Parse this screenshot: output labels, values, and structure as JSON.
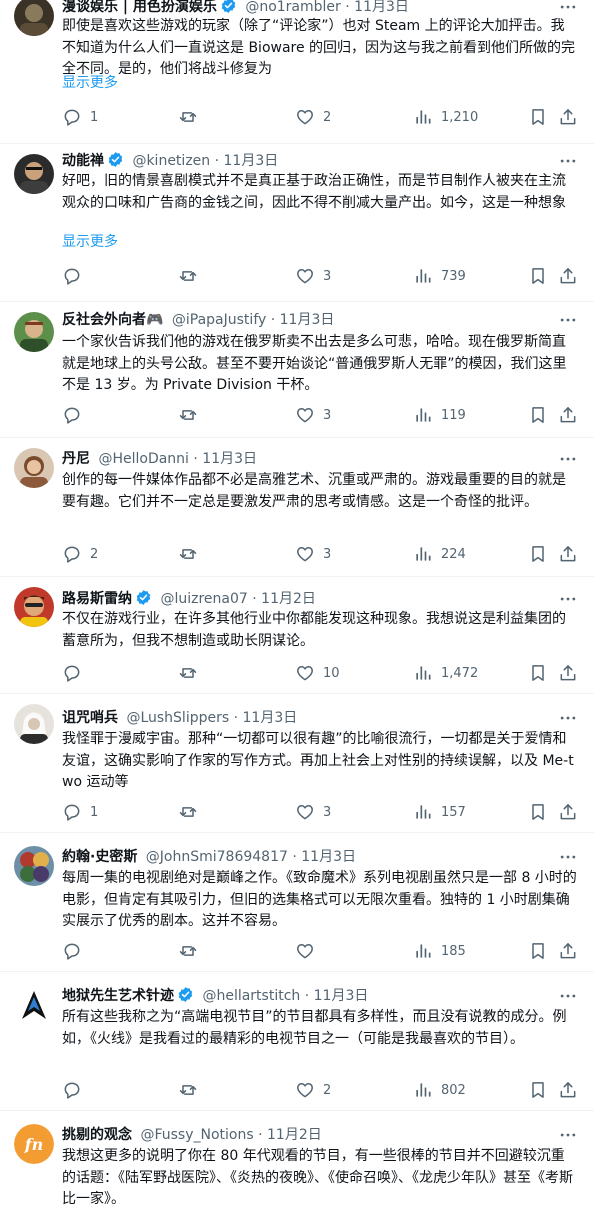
{
  "tweets": [
    {
      "name": "漫谈娱乐 | 用色扮演娱乐",
      "verified": true,
      "handle": "@no1rambler",
      "date": "11月3日",
      "text": "即使是喜欢这些游戏的玩家（除了“评论家”）也对 Steam 上的评论大加抨击。我不知道为什么人们一直说这是 Bioware 的回归，因为这与我之前看到他们所做的完全不同。是的，他们将战斗修复为",
      "show_more": "显示更多",
      "replies": "1",
      "retweets": "",
      "likes": "2",
      "views": "1,210"
    },
    {
      "name": "动能禅",
      "verified": true,
      "handle": "@kinetizen",
      "date": "11月3日",
      "text": "好吧，旧的情景喜剧模式并不是真正基于政治正确性，而是节目制作人被夹在主流观众的口味和广告商的金钱之间，因此不得不削减大量产出。如今，这是一种想象",
      "show_more": "显示更多",
      "replies": "",
      "retweets": "",
      "likes": "3",
      "views": "739"
    },
    {
      "name": "反社会外向者🎮",
      "verified": false,
      "handle": "@iPapaJustify",
      "date": "11月3日",
      "text": "一个家伙告诉我们他的游戏在俄罗斯卖不出去是多么可悲，哈哈。现在俄罗斯简直就是地球上的头号公敌。甚至不要开始谈论“普通俄罗斯人无罪”的模因，我们这里不是 13 岁。为 Private Division 干杯。",
      "show_more": "",
      "replies": "",
      "retweets": "",
      "likes": "3",
      "views": "119"
    },
    {
      "name": "丹尼",
      "verified": false,
      "handle": "@HelloDanni",
      "date": "11月3日",
      "text": "创作的每一件媒体作品都不必是高雅艺术、沉重或严肃的。游戏最重要的目的就是要有趣。它们并不一定总是要激发严肃的思考或情感。这是一个奇怪的批评。",
      "show_more": "",
      "replies": "2",
      "retweets": "",
      "likes": "3",
      "views": "224"
    },
    {
      "name": "路易斯雷纳",
      "verified": true,
      "handle": "@luizrena07",
      "date": "11月2日",
      "text": "不仅在游戏行业，在许多其他行业中你都能发现这种现象。我想说这是利益集团的蓄意所为，但我不想制造或助长阴谋论。",
      "show_more": "",
      "replies": "",
      "retweets": "",
      "likes": "10",
      "views": "1,472"
    },
    {
      "name": "诅咒哨兵",
      "verified": false,
      "handle": "@LushSlippers",
      "date": "11月3日",
      "text": "我怪罪于漫威宇宙。那种“一切都可以很有趣”的比喻很流行，一切都是关于爱情和友谊，这确实影响了作家的写作方式。再加上社会上对性别的持续误解，以及 Me-two 运动等",
      "show_more": "",
      "replies": "1",
      "retweets": "",
      "likes": "3",
      "views": "157"
    },
    {
      "name": "約翰·史密斯",
      "verified": false,
      "handle": "@JohnSmi78694817",
      "date": "11月3日",
      "text": "每周一集的电视剧绝对是巅峰之作。《致命魔术》系列电视剧虽然只是一部 8 小时的电影，但肯定有其吸引力，但旧的选集格式可以无限次重看。独特的 1 小时剧集确实展示了优秀的剧本。这并不容易。",
      "show_more": "",
      "replies": "",
      "retweets": "",
      "likes": "",
      "views": "185"
    },
    {
      "name": "地狱先生艺术针迹",
      "verified": true,
      "handle": "@hellartstitch",
      "date": "11月3日",
      "text": "所有这些我称之为“高端电视节目”的节目都具有多样性，而且没有说教的成分。例如，《火线》是我看过的最精彩的电视节目之一（可能是我最喜欢的节目）。",
      "show_more": "",
      "replies": "",
      "retweets": "",
      "likes": "2",
      "views": "802"
    },
    {
      "name": "挑剔的观念",
      "verified": false,
      "handle": "@Fussy_Notions",
      "date": "11月2日",
      "text": "我想这更多的说明了你在 80 年代观看的节目，有一些很棒的节目并不回避较沉重的话题：《陆军野战医院》、《炎热的夜晚》、《使命召唤》、《龙虎少年队》甚至《考斯比一家》。",
      "show_more": "",
      "replies": "",
      "retweets": "",
      "likes": "",
      "views": ""
    }
  ],
  "separator": "·",
  "colors": {
    "accent": "#1d9bf0",
    "secondary_text": "#536471",
    "border": "#eff3f4"
  },
  "icons": [
    "reply-icon",
    "retweet-icon",
    "like-icon",
    "views-icon",
    "bookmark-icon",
    "share-icon",
    "more-icon",
    "verified-badge-icon"
  ]
}
